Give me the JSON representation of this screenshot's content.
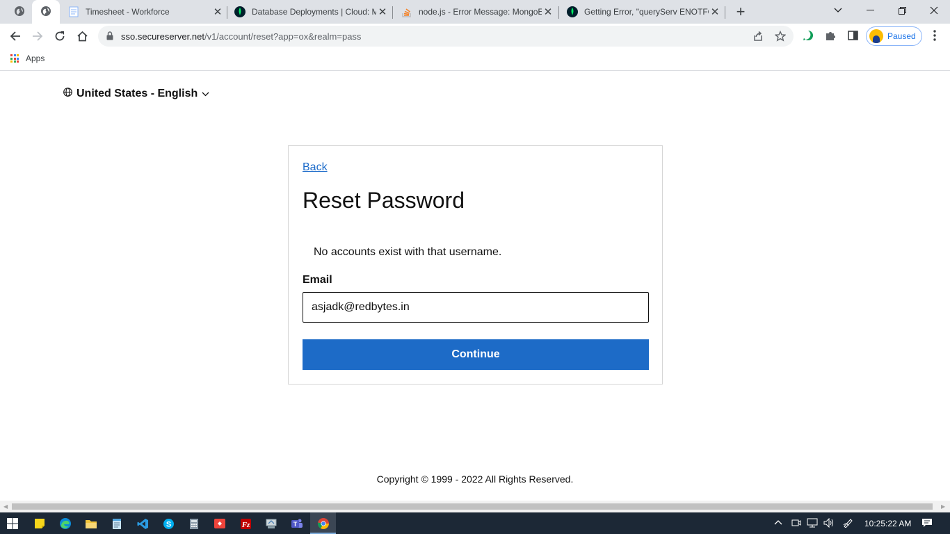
{
  "browser": {
    "tabs": [
      {
        "title": "",
        "icon": "globe-icon"
      },
      {
        "title": "",
        "icon": "globe-icon",
        "active": true
      },
      {
        "title": "Timesheet - Workforce",
        "icon": "document-icon"
      },
      {
        "title": "Database Deployments | Cloud: M",
        "icon": "mongodb-leaf-icon"
      },
      {
        "title": "node.js - Error Message: MongoE",
        "icon": "stackoverflow-icon"
      },
      {
        "title": "Getting Error, \"queryServ ENOTFO",
        "icon": "mongodb-leaf-icon"
      }
    ],
    "url_host": "sso.secureserver.net",
    "url_path": "/v1/account/reset?app=ox&realm=pass",
    "profile_status": "Paused",
    "bookmarks": {
      "apps_label": "Apps"
    }
  },
  "page": {
    "locale": "United States - English",
    "back": "Back",
    "title": "Reset Password",
    "notice": "No accounts exist with that username.",
    "email_label": "Email",
    "email_value": "asjadk@redbytes.in",
    "continue_label": "Continue",
    "copyright": "Copyright © 1999 - 2022 All Rights Reserved."
  },
  "colors": {
    "primary_button": "#1d6bc7",
    "link": "#1b6ac9",
    "taskbar": "#1c2836"
  },
  "taskbar": {
    "apps": [
      "windows-start-icon",
      "sticky-notes-icon",
      "edge-icon",
      "file-explorer-icon",
      "notepad-icon",
      "vscode-icon",
      "skype-icon",
      "calculator-icon",
      "anydesk-icon",
      "filezilla-icon",
      "network-drive-icon",
      "teams-icon",
      "chrome-icon"
    ],
    "clock": "10:25:22 AM"
  }
}
